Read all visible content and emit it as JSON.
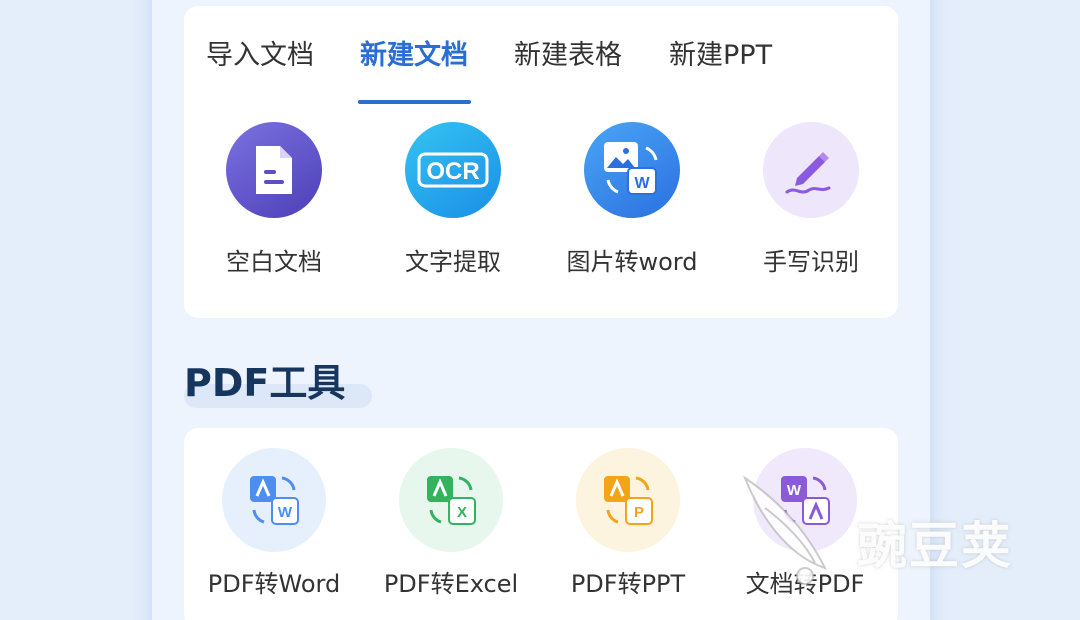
{
  "tabs": [
    {
      "label": "导入文档"
    },
    {
      "label": "新建文档",
      "active": true
    },
    {
      "label": "新建表格"
    },
    {
      "label": "新建PPT"
    }
  ],
  "create_tools": [
    {
      "label": "空白文档",
      "icon": "blank-document-icon"
    },
    {
      "label": "文字提取",
      "icon": "ocr-icon",
      "badge": "OCR"
    },
    {
      "label": "图片转word",
      "icon": "image-to-word-icon",
      "badge": "W"
    },
    {
      "label": "手写识别",
      "icon": "handwriting-pen-icon"
    }
  ],
  "pdf_section": {
    "title": "PDF工具"
  },
  "pdf_tools": [
    {
      "label": "PDF转Word",
      "icon": "pdf-to-word-icon",
      "badge": "W"
    },
    {
      "label": "PDF转Excel",
      "icon": "pdf-to-excel-icon",
      "badge": "X"
    },
    {
      "label": "PDF转PPT",
      "icon": "pdf-to-ppt-icon",
      "badge": "P"
    },
    {
      "label": "文档转PDF",
      "icon": "word-to-pdf-icon",
      "badge": "W"
    }
  ],
  "watermark": {
    "text": "豌豆荚"
  },
  "colors": {
    "accent": "#2a6ed3",
    "page_bg": "#eef4fd",
    "card_bg": "#ffffff",
    "section_title": "#17365d"
  }
}
